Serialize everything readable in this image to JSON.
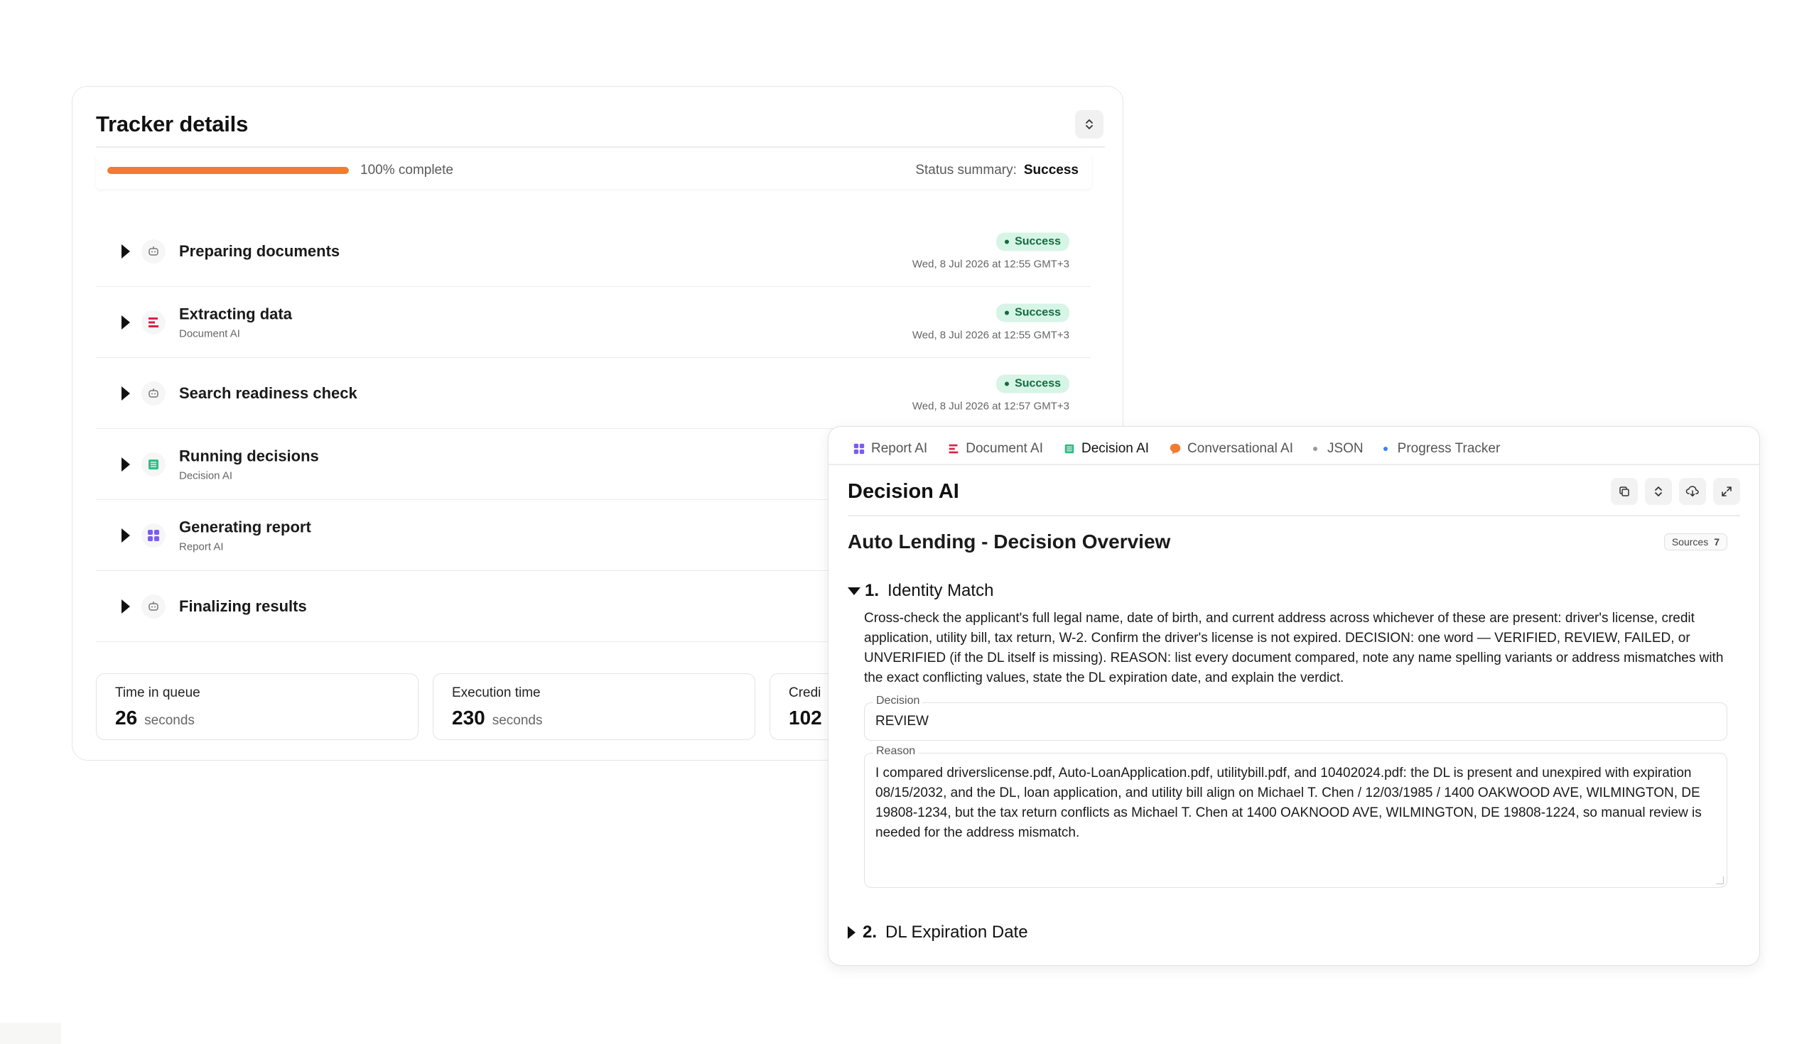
{
  "tracker": {
    "title": "Tracker details",
    "progress": {
      "fraction": 1.0,
      "label": "100% complete"
    },
    "status_summary": {
      "label": "Status summary:",
      "value": "Success"
    },
    "steps": [
      {
        "title": "Preparing documents",
        "subtitle": "",
        "icon": "robot-icon",
        "status": "Success",
        "time": "Wed, 8 Jul 2026 at 12:55 GMT+3"
      },
      {
        "title": "Extracting data",
        "subtitle": "Document AI",
        "icon": "document-ai-icon",
        "status": "Success",
        "time": "Wed, 8 Jul 2026 at 12:55 GMT+3"
      },
      {
        "title": "Search readiness check",
        "subtitle": "",
        "icon": "robot-icon",
        "status": "Success",
        "time": "Wed, 8 Jul 2026 at 12:57 GMT+3"
      },
      {
        "title": "Running decisions",
        "subtitle": "Decision AI",
        "icon": "decision-ai-icon"
      },
      {
        "title": "Generating report",
        "subtitle": "Report AI",
        "icon": "report-ai-icon"
      },
      {
        "title": "Finalizing results",
        "subtitle": "",
        "icon": "robot-icon"
      }
    ],
    "metrics": [
      {
        "label": "Time in queue",
        "value": "26",
        "unit": "seconds"
      },
      {
        "label": "Execution time",
        "value": "230",
        "unit": "seconds"
      },
      {
        "label": "Credi",
        "value": "102",
        "unit": ""
      }
    ]
  },
  "panel": {
    "tabs": [
      {
        "label": "Report AI",
        "icon": "report-ai-icon"
      },
      {
        "label": "Document AI",
        "icon": "document-ai-icon"
      },
      {
        "label": "Decision AI",
        "icon": "decision-ai-icon",
        "active": true
      },
      {
        "label": "Conversational AI",
        "icon": "chat-icon"
      },
      {
        "label": "JSON",
        "icon": "dot-icon"
      },
      {
        "label": "Progress Tracker",
        "icon": "dot-icon"
      }
    ],
    "title": "Decision AI",
    "report_title": "Auto Lending - Decision Overview",
    "sources": {
      "label": "Sources",
      "count": "7"
    },
    "sections": [
      {
        "number": "1.",
        "title": "Identity Match",
        "expanded": true,
        "description": "Cross-check the applicant's full legal name, date of birth, and current address across whichever of these are present: driver's license, credit application, utility bill, tax return, W-2. Confirm the driver's license is not expired. DECISION: one word — VERIFIED, REVIEW, FAILED, or UNVERIFIED (if the DL itself is missing). REASON: list every document compared, note any name spelling variants or address mismatches with the exact conflicting values, state the DL expiration date, and explain the verdict.",
        "decision_label": "Decision",
        "decision_value": "REVIEW",
        "reason_label": "Reason",
        "reason_value": "I compared driverslicense.pdf, Auto-LoanApplication.pdf, utilitybill.pdf, and 10402024.pdf: the DL is present and unexpired with expiration 08/15/2032, and the DL, loan application, and utility bill align on Michael T. Chen / 12/03/1985 / 1400 OAKWOOD AVE, WILMINGTON, DE 19808-1234, but the tax return conflicts as Michael T. Chen at 1400 OAKNOOD AVE, WILMINGTON, DE 19808-1224, so manual review is needed for the address mismatch."
      },
      {
        "number": "2.",
        "title": "DL Expiration Date",
        "expanded": false
      }
    ]
  },
  "colors": {
    "accent": "#f47a32",
    "success_bg": "#d7f5e6",
    "success_text": "#146b40",
    "document_ai": "#d9224a",
    "decision_ai": "#2fbf87",
    "report_ai": "#7b5cf5",
    "conversational_ai": "#f47a32",
    "progress_tracker_dot": "#3b82f6",
    "json_dot": "#999999"
  }
}
